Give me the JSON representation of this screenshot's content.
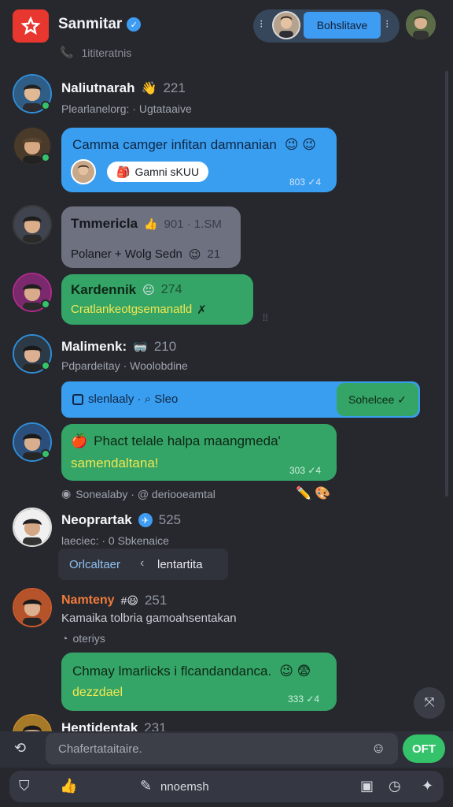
{
  "header": {
    "title": "Sanmitar",
    "subtitle": "1ititeratnis",
    "action_button": "Bohslitave"
  },
  "messages": [
    {
      "name": "Naliutnarah",
      "emoji": "👋",
      "count": "221",
      "meta": "Plearlanelorg: · Ugtataaive"
    },
    {
      "text": "Camma camger infitan damnanian",
      "emojis": "😉 😉",
      "pill": "Gamni sKUU",
      "stamp": "803 ✓4"
    },
    {
      "name": "Tmmericla",
      "emoji": "👍",
      "count": "901 · 1.SM",
      "line2": "Polaner + Wolg Sedn",
      "line2_emoji": "😉",
      "line2_tail": "21"
    },
    {
      "name": "Kardennik",
      "emoji": "😐",
      "count": "274",
      "line2": "Cratlankeotgsemanatld",
      "line2_emoji": "✗"
    },
    {
      "name": "Malimenk:",
      "emoji": "🥽",
      "count": "210",
      "meta": "Pdpardeitay · Woolobdine"
    },
    {
      "left": "slenlaaly · ⌕ Sleo",
      "right": "Sohelcee ✓"
    },
    {
      "text": "Phact telale halpa maangmeda'",
      "text2": "samendaltana!",
      "stamp": "303 ✓4"
    },
    {
      "meta": "Sonealaby · @ deriooeamtal"
    },
    {
      "name": "Neoprartak",
      "emoji": "✈",
      "count": "525",
      "meta": "laeciec: · 0 Sbkenaice"
    },
    {
      "tab1": "Orlcaltaer",
      "tab2": "lentartita"
    },
    {
      "name": "Namteny",
      "emoji": "#😃",
      "count": "251",
      "meta": "Kamaika tolbria gamoahsentakan",
      "meta2": "oteriys"
    },
    {
      "text": "Chmay lmarlicks i flcandandanca.",
      "emojis": "😉 😨",
      "text2": "dezzdael",
      "stamp": "333 ✓4"
    },
    {
      "name": "Hentidentak",
      "count": "231"
    }
  ],
  "composer": {
    "placeholder": "Chafertataitaire.",
    "send_label": "OFT",
    "bottom_label": "nnoemsh"
  },
  "colors": {
    "background": "#26282e",
    "blue_bubble": "#3a9ef0",
    "green_bubble": "#34a567",
    "gray_bubble": "#6e7180",
    "send": "#34c36b"
  }
}
